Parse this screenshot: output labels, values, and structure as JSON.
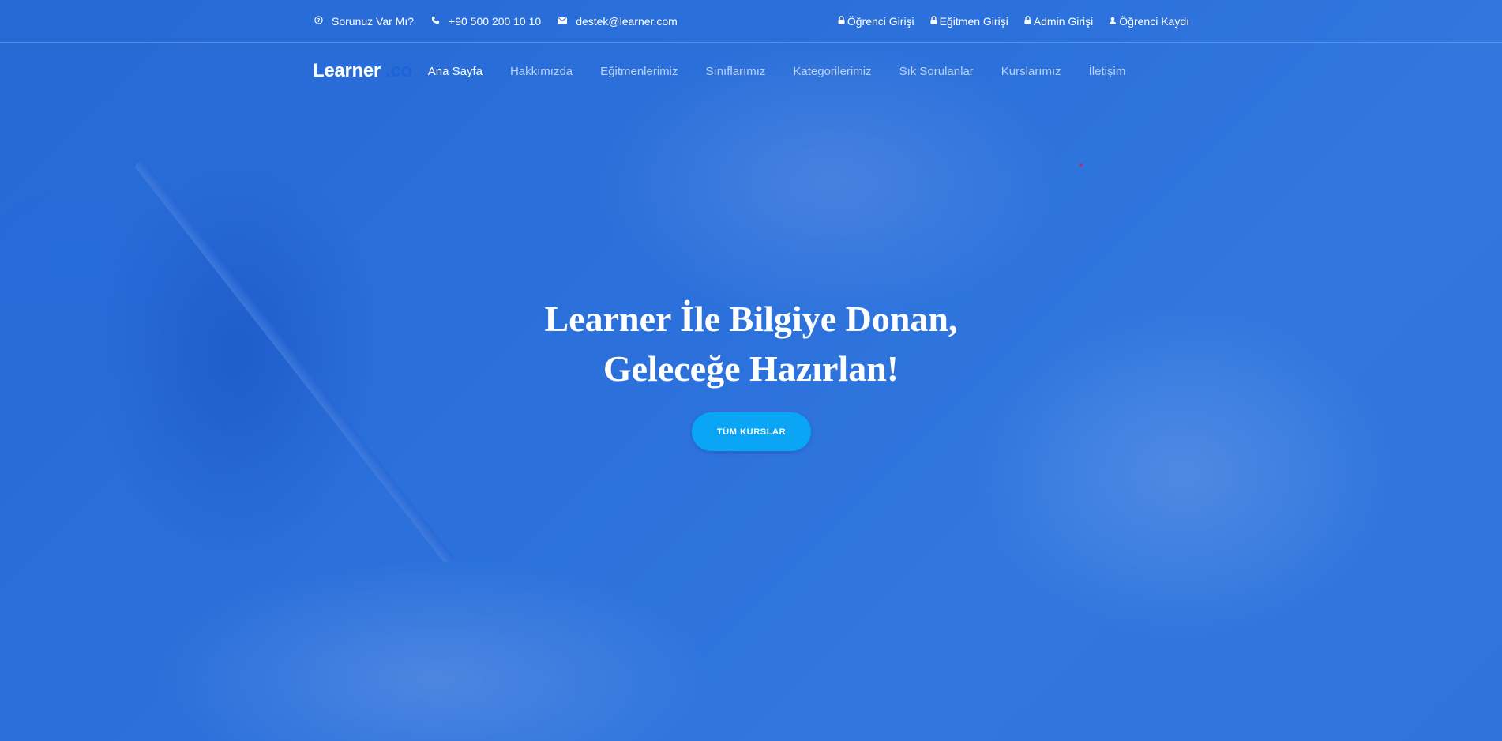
{
  "topbar": {
    "question_icon": "question-circle-icon",
    "question_text": "Sorunuz Var Mı?",
    "phone_icon": "phone-icon",
    "phone_text": "+90 500 200 10 10",
    "email_icon": "envelope-icon",
    "email_text": "destek@learner.com",
    "links": [
      {
        "icon": "lock-icon",
        "label": "Öğrenci Girişi"
      },
      {
        "icon": "lock-icon",
        "label": "Eğitmen Girişi"
      },
      {
        "icon": "lock-icon",
        "label": "Admin Girişi"
      },
      {
        "icon": "user-icon",
        "label": "Öğrenci Kaydı"
      }
    ]
  },
  "nav": {
    "logo_main": "Learner",
    "logo_suffix": ".co",
    "items": [
      {
        "label": "Ana Sayfa",
        "active": true
      },
      {
        "label": "Hakkımızda",
        "active": false
      },
      {
        "label": "Eğitmenlerimiz",
        "active": false
      },
      {
        "label": "Sınıflarımız",
        "active": false
      },
      {
        "label": "Kategorilerimiz",
        "active": false
      },
      {
        "label": "Sık Sorulanlar",
        "active": false
      },
      {
        "label": "Kurslarımız",
        "active": false
      },
      {
        "label": "İletişim",
        "active": false
      }
    ]
  },
  "hero": {
    "title_line1": "Learner İle Bilgiye Donan,",
    "title_line2": "Geleceğe Hazırlan!",
    "button_label": "TÜM KURSLAR"
  },
  "colors": {
    "overlay_blue": "#2f72d6",
    "button_blue": "#0aa5f5",
    "logo_accent": "#1b63d8"
  }
}
